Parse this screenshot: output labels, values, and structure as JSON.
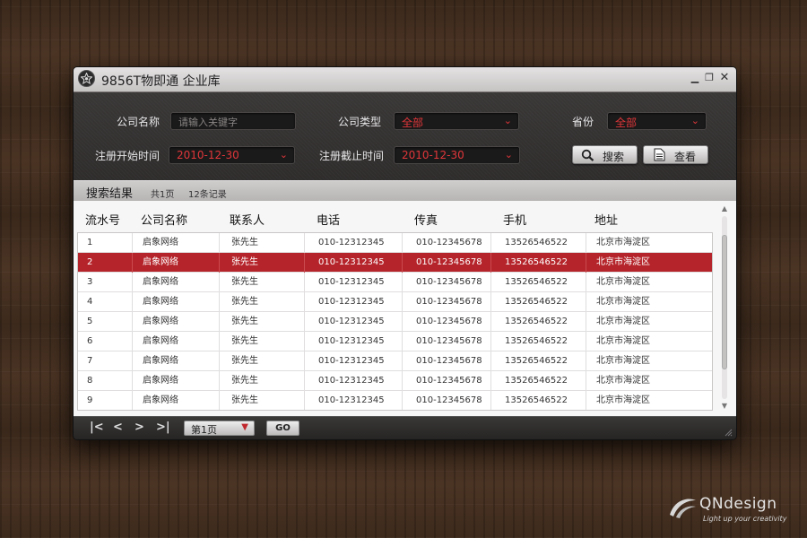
{
  "window": {
    "title": "9856T物即通  企业库"
  },
  "filters": {
    "company_name_label": "公司名称",
    "company_name_placeholder": "请输入关键字",
    "company_type_label": "公司类型",
    "company_type_value": "全部",
    "province_label": "省份",
    "province_value": "全部",
    "reg_start_label": "注册开始时间",
    "reg_start_value": "2010-12-30",
    "reg_end_label": "注册截止时间",
    "reg_end_value": "2010-12-30",
    "search_button": "搜索",
    "view_button": "查看"
  },
  "results": {
    "title": "搜索结果",
    "pages": "共1页",
    "records": "12条记录"
  },
  "table": {
    "headers": [
      "流水号",
      "公司名称",
      "联系人",
      "电话",
      "传真",
      "手机",
      "地址"
    ],
    "selected_row": 2,
    "rows": [
      [
        "1",
        "启象网络",
        "张先生",
        "010-12312345",
        "010-12345678",
        "13526546522",
        "北京市海淀区"
      ],
      [
        "2",
        "启象网络",
        "张先生",
        "010-12312345",
        "010-12345678",
        "13526546522",
        "北京市海淀区"
      ],
      [
        "3",
        "启象网络",
        "张先生",
        "010-12312345",
        "010-12345678",
        "13526546522",
        "北京市海淀区"
      ],
      [
        "4",
        "启象网络",
        "张先生",
        "010-12312345",
        "010-12345678",
        "13526546522",
        "北京市海淀区"
      ],
      [
        "5",
        "启象网络",
        "张先生",
        "010-12312345",
        "010-12345678",
        "13526546522",
        "北京市海淀区"
      ],
      [
        "6",
        "启象网络",
        "张先生",
        "010-12312345",
        "010-12345678",
        "13526546522",
        "北京市海淀区"
      ],
      [
        "7",
        "启象网络",
        "张先生",
        "010-12312345",
        "010-12345678",
        "13526546522",
        "北京市海淀区"
      ],
      [
        "8",
        "启象网络",
        "张先生",
        "010-12312345",
        "010-12345678",
        "13526546522",
        "北京市海淀区"
      ],
      [
        "9",
        "启象网络",
        "张先生",
        "010-12312345",
        "010-12345678",
        "13526546522",
        "北京市海淀区"
      ]
    ]
  },
  "pagination": {
    "page_value": "第1页",
    "go_button": "GO"
  },
  "watermark": {
    "brand": "QNdesign",
    "tagline": "Light up your creativity"
  },
  "colors": {
    "accent": "#e0363a",
    "selected_row": "#b5242a"
  }
}
